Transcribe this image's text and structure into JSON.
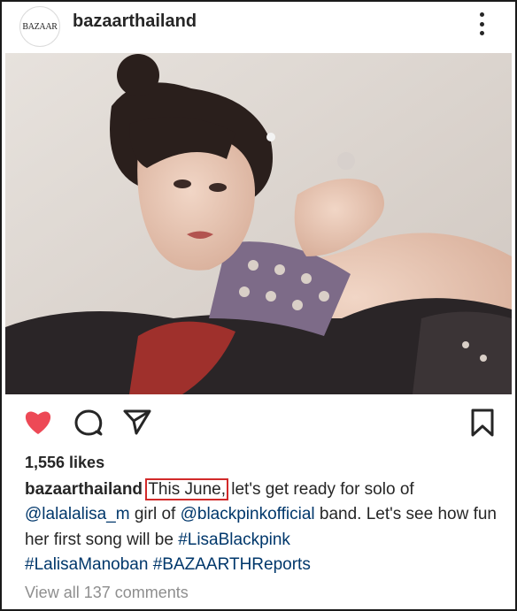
{
  "header": {
    "avatar_text": "BAZAAR",
    "username": "bazaarthailand",
    "more_icon": "more-vertical-icon"
  },
  "post": {
    "tag_icon": "user-tag-icon",
    "like_color": "#ed4956",
    "link_color": "#00376b"
  },
  "actions": {
    "like_icon": "heart-icon",
    "comment_icon": "comment-icon",
    "share_icon": "paper-plane-icon",
    "save_icon": "bookmark-icon"
  },
  "likes": "1,556 likes",
  "caption": {
    "username": "bazaarthailand",
    "highlight": "This June,",
    "text1": " let's get ready for solo of ",
    "mention1": "@lalalalisa_m",
    "text2": " girl of ",
    "mention2": "@blackpinkofficial",
    "text3": " band. Let's see how fun her first song will be ",
    "hashtag1": "#LisaBlackpink",
    "space": " ",
    "hashtag2": "#LalisaManoban",
    "hashtag3": "#BAZAARTHReports"
  },
  "comments_link": "View all 137 comments"
}
